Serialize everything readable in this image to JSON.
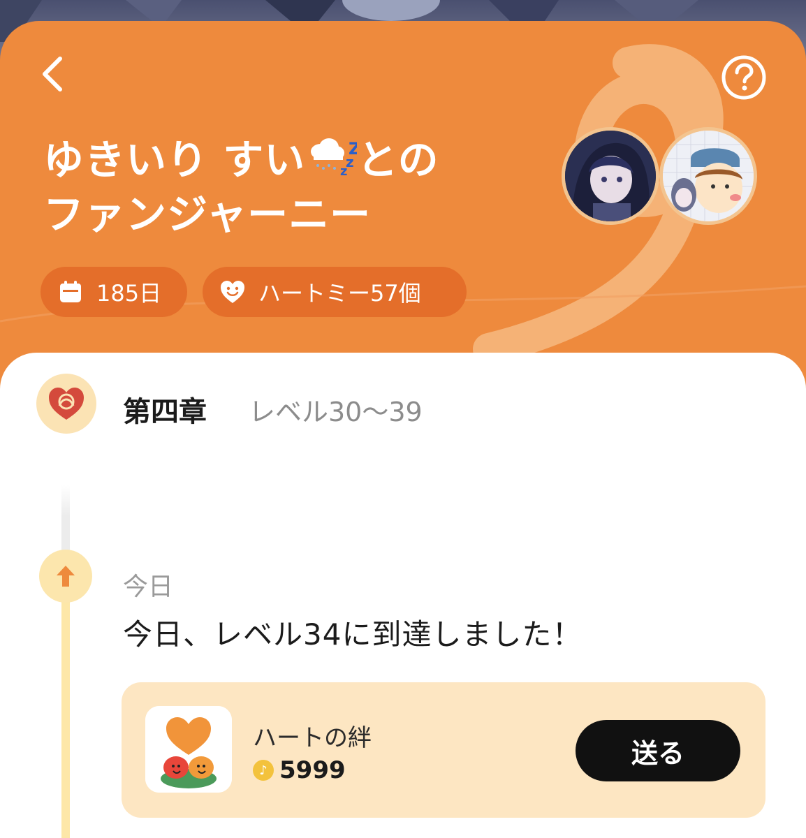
{
  "header": {
    "title_line1": "ゆきいり すい",
    "title_line1_suffix": "との",
    "title_line2": "ファンジャーニー",
    "back_icon": "chevron-left-icon",
    "help_icon": "question-circle-icon",
    "title_emoji": "cloud-rain-sleep-emoji"
  },
  "chips": {
    "days_label": "185日",
    "days_icon": "calendar-icon",
    "hearts_label": "ハートミー57個",
    "hearts_icon": "heart-smile-icon"
  },
  "chapter": {
    "title": "第四章",
    "range": "レベル30〜39",
    "badge_icon": "heart-knot-icon"
  },
  "entry": {
    "date": "今日",
    "text": "今日、レベル34に到達しました！",
    "badge_icon": "arrow-up-icon"
  },
  "gift": {
    "name": "ハートの絆",
    "price": "5999",
    "currency_icon": "coin-icon",
    "send_label": "送る"
  },
  "colors": {
    "header_bg": "#ee8a3d",
    "chip_bg": "#e46e2a",
    "gift_card_bg": "#fde6c2",
    "timeline_yellow": "#fde7a8",
    "send_button_bg": "#111111"
  }
}
